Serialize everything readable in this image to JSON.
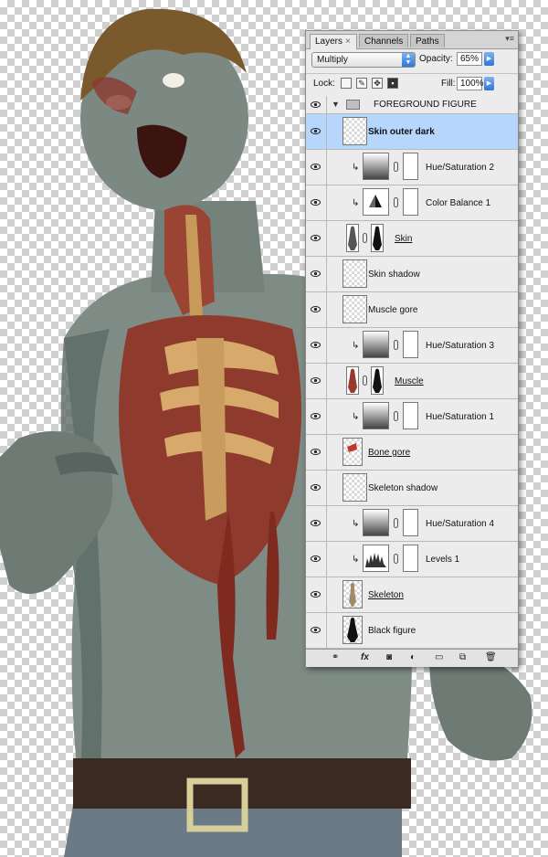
{
  "panel": {
    "tabs": [
      {
        "label": "Layers",
        "close": "×",
        "active": true
      },
      {
        "label": "Channels",
        "active": false
      },
      {
        "label": "Paths",
        "active": false
      }
    ],
    "blend_mode": "Multiply",
    "opacity_label": "Opacity:",
    "opacity_value": "65%",
    "lock_label": "Lock:",
    "fill_label": "Fill:",
    "fill_value": "100%"
  },
  "layers": [
    {
      "name": "FOREGROUND FIGURE",
      "kind": "group",
      "visible": true
    },
    {
      "name": "Skin outer dark",
      "kind": "pixel",
      "selected": true,
      "visible": true
    },
    {
      "name": "Hue/Saturation 2",
      "kind": "adjustment",
      "clipped": true,
      "visible": true
    },
    {
      "name": "Color Balance 1",
      "kind": "adjustment",
      "clipped": true,
      "visible": true
    },
    {
      "name": "Skin",
      "kind": "masked",
      "visible": true
    },
    {
      "name": "Skin shadow",
      "kind": "pixel",
      "visible": true
    },
    {
      "name": "Muscle gore",
      "kind": "pixel",
      "visible": true
    },
    {
      "name": "Hue/Saturation 3",
      "kind": "adjustment",
      "clipped": true,
      "visible": true
    },
    {
      "name": "Muscle",
      "kind": "masked",
      "visible": true
    },
    {
      "name": "Hue/Saturation 1",
      "kind": "adjustment",
      "clipped": true,
      "visible": true
    },
    {
      "name": "Bone gore",
      "kind": "pixel",
      "visible": true
    },
    {
      "name": "Skeleton shadow",
      "kind": "pixel",
      "visible": true
    },
    {
      "name": "Hue/Saturation 4",
      "kind": "adjustment",
      "clipped": true,
      "visible": true
    },
    {
      "name": "Levels 1",
      "kind": "adjustment",
      "clipped": true,
      "visible": true
    },
    {
      "name": "Skeleton",
      "kind": "pixel",
      "visible": true
    },
    {
      "name": "Black figure",
      "kind": "pixel",
      "visible": true
    }
  ],
  "footer_icons": [
    "link-icon",
    "fx-icon",
    "mask-icon",
    "adjustment-icon",
    "folder-icon",
    "new-layer-icon",
    "trash-icon"
  ],
  "colors": {
    "selection": "#b7d6fb",
    "skin": "#7e8b85",
    "hair": "#7a5a2c",
    "gore": "#8a2e22",
    "belt": "#3a2a22",
    "buckle": "#d6cf9a",
    "jeans": "#6a7a86"
  }
}
